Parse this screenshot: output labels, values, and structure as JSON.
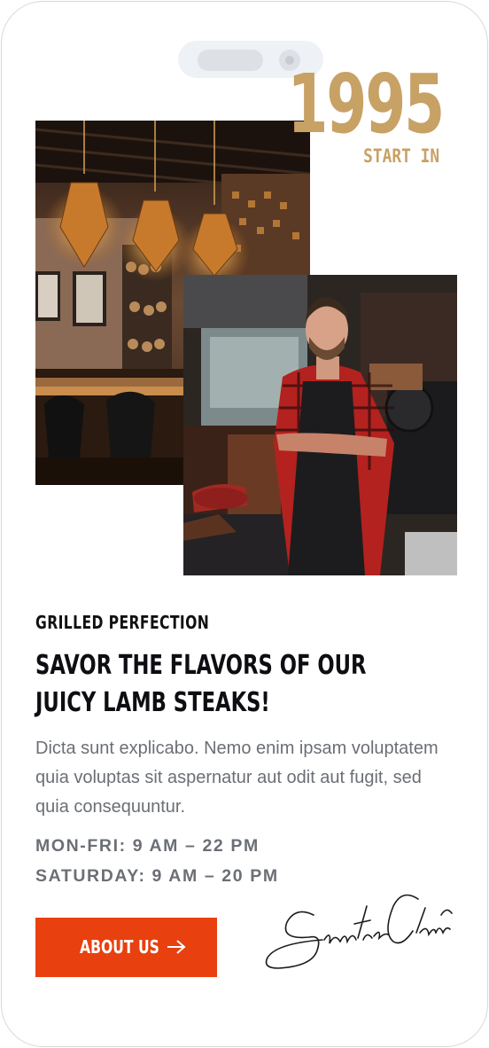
{
  "badge": {
    "year": "1995",
    "caption": "START IN"
  },
  "images": {
    "restaurant": {
      "alt": "restaurant interior"
    },
    "chef": {
      "alt": "chef"
    }
  },
  "section": {
    "eyebrow": "GRILLED PERFECTION",
    "headline": "SAVOR THE FLAVORS OF OUR JUICY LAMB STEAKS!",
    "body": "Dicta sunt explicabo. Nemo enim ipsam voluptatem quia voluptas sit aspernatur aut odit aut fugit, sed quia consequuntur."
  },
  "hours": [
    "MON-FRI: 9 AM – 22 PM",
    "SATURDAY: 9 AM – 20 PM"
  ],
  "cta": {
    "label": "ABOUT US",
    "icon": "arrow-right-icon"
  },
  "signature": {
    "text": "Santa Claus"
  },
  "colors": {
    "accent": "#e8400f",
    "gold": "#c8a165",
    "text_dark": "#0d0d12",
    "text_muted": "#6b6f75"
  }
}
